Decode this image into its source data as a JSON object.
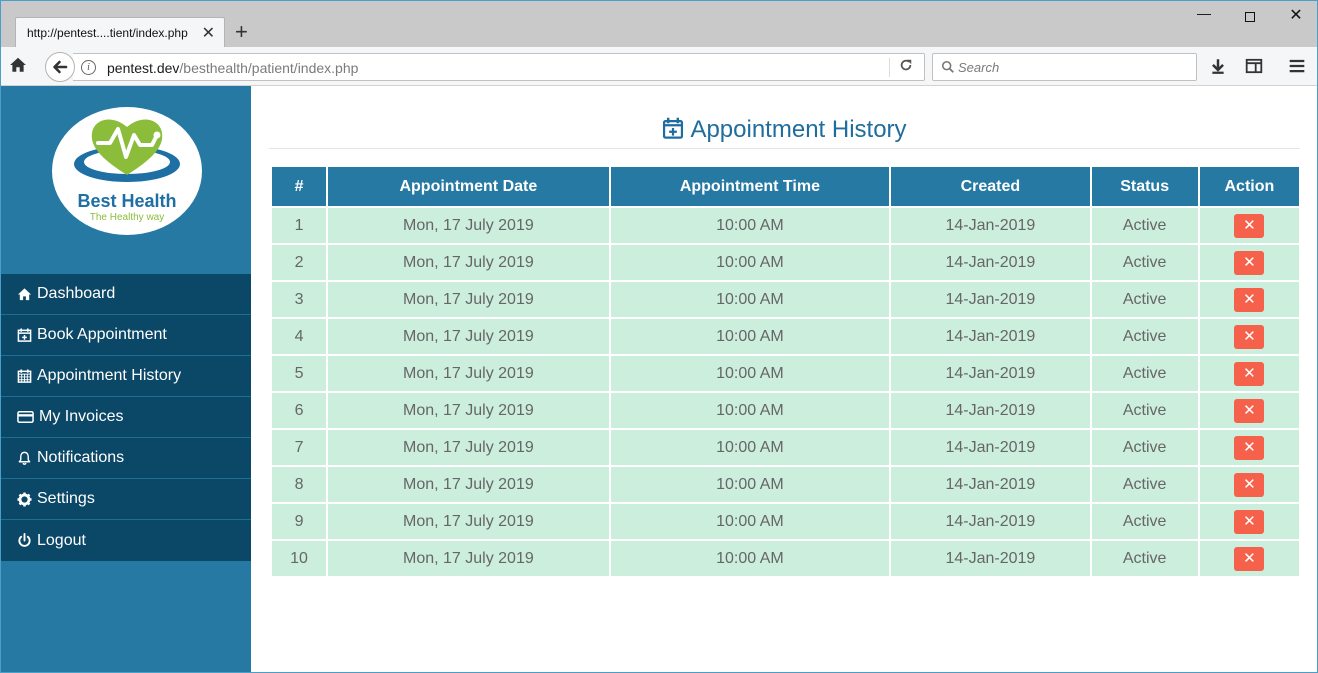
{
  "browser": {
    "tab_title": "http://pentest....tient/index.php",
    "tab_close_glyph": "✕",
    "new_tab_glyph": "+",
    "url_host": "pentest.dev",
    "url_path": "/besthealth/patient/index.php",
    "search_placeholder": "Search",
    "window_min_glyph": "—",
    "window_close_glyph": "✕"
  },
  "brand": {
    "name": "Best Health",
    "tagline": "The Healthy way",
    "primary_color": "#2679a2",
    "dark_color": "#0b4766",
    "accent_green": "#8bbd3b"
  },
  "sidebar": {
    "items": [
      {
        "label": "Dashboard",
        "icon": "home-icon"
      },
      {
        "label": "Book Appointment",
        "icon": "calendar-plus-icon"
      },
      {
        "label": "Appointment History",
        "icon": "calendar-icon"
      },
      {
        "label": "My Invoices",
        "icon": "credit-card-icon"
      },
      {
        "label": "Notifications",
        "icon": "bell-icon"
      },
      {
        "label": "Settings",
        "icon": "gear-icon"
      },
      {
        "label": "Logout",
        "icon": "power-icon"
      }
    ]
  },
  "main": {
    "title": "Appointment History",
    "table": {
      "headers": [
        "#",
        "Appointment Date",
        "Appointment Time",
        "Created",
        "Status",
        "Action"
      ],
      "delete_glyph": "✕",
      "rows": [
        [
          "1",
          "Mon, 17 July 2019",
          "10:00 AM",
          "14-Jan-2019",
          "Active"
        ],
        [
          "2",
          "Mon, 17 July 2019",
          "10:00 AM",
          "14-Jan-2019",
          "Active"
        ],
        [
          "3",
          "Mon, 17 July 2019",
          "10:00 AM",
          "14-Jan-2019",
          "Active"
        ],
        [
          "4",
          "Mon, 17 July 2019",
          "10:00 AM",
          "14-Jan-2019",
          "Active"
        ],
        [
          "5",
          "Mon, 17 July 2019",
          "10:00 AM",
          "14-Jan-2019",
          "Active"
        ],
        [
          "6",
          "Mon, 17 July 2019",
          "10:00 AM",
          "14-Jan-2019",
          "Active"
        ],
        [
          "7",
          "Mon, 17 July 2019",
          "10:00 AM",
          "14-Jan-2019",
          "Active"
        ],
        [
          "8",
          "Mon, 17 July 2019",
          "10:00 AM",
          "14-Jan-2019",
          "Active"
        ],
        [
          "9",
          "Mon, 17 July 2019",
          "10:00 AM",
          "14-Jan-2019",
          "Active"
        ],
        [
          "10",
          "Mon, 17 July 2019",
          "10:00 AM",
          "14-Jan-2019",
          "Active"
        ]
      ]
    }
  }
}
